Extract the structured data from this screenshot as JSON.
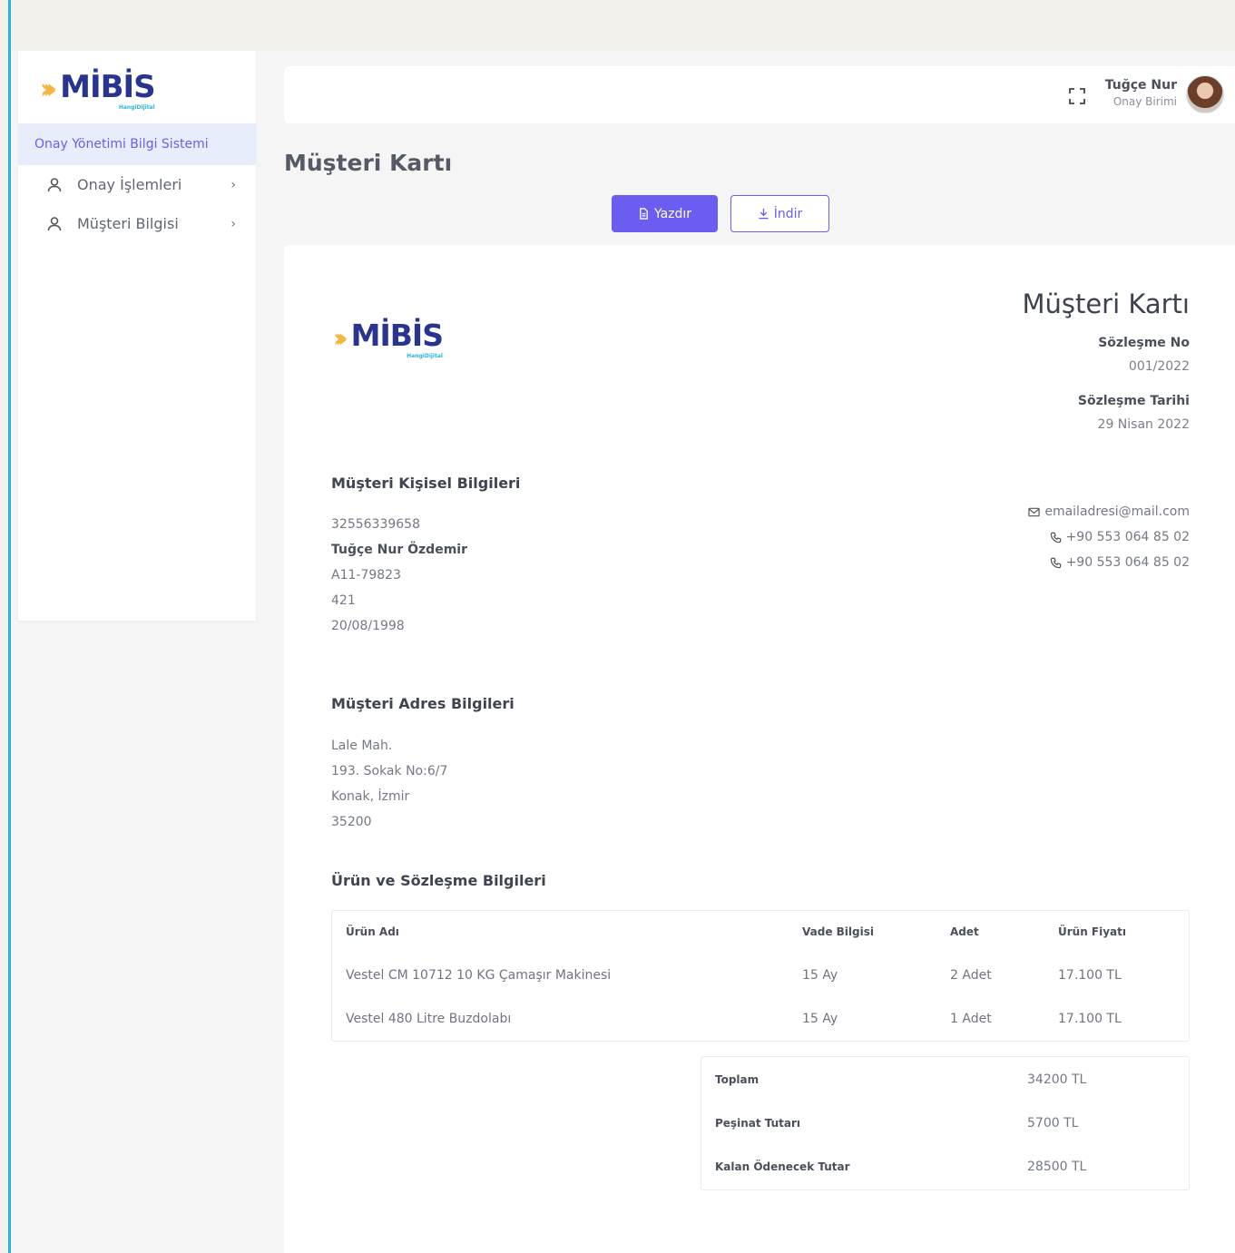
{
  "brand": {
    "name": "MİBİS",
    "tagline": "HangiDijital"
  },
  "sidebar": {
    "system_title": "Onay Yönetimi Bilgi Sistemi",
    "items": [
      {
        "label": "Onay İşlemleri",
        "icon": "user-icon"
      },
      {
        "label": "Müşteri Bilgisi",
        "icon": "user-icon"
      }
    ]
  },
  "header": {
    "user_name": "Tuğçe Nur",
    "user_role": "Onay Birimi"
  },
  "page": {
    "title": "Müşteri Kartı",
    "print_label": "Yazdır",
    "download_label": "İndir"
  },
  "card": {
    "title": "Müşteri Kartı",
    "contract_no_label": "Sözleşme No",
    "contract_no": "001/2022",
    "contract_date_label": "Sözleşme Tarihi",
    "contract_date": "29 Nisan 2022",
    "personal": {
      "title": "Müşteri Kişisel Bilgileri",
      "id_number": "32556339658",
      "full_name": "Tuğçe Nur Özdemir",
      "serial": "A11-79823",
      "code": "421",
      "birth_date": "20/08/1998"
    },
    "contact": {
      "email": "emailadresi@mail.com",
      "phone1": "+90 553 064 85 02",
      "phone2": "+90 553 064 85 02"
    },
    "address": {
      "title": "Müşteri Adres Bilgileri",
      "line1": "Lale Mah.",
      "line2": "193. Sokak No:6/7",
      "line3": "Konak, İzmir",
      "postal": "35200"
    },
    "products": {
      "title": "Ürün ve Sözleşme Bilgileri",
      "headers": [
        "Ürün Adı",
        "Vade Bilgisi",
        "Adet",
        "Ürün Fiyatı"
      ],
      "rows": [
        [
          "Vestel CM 10712 10 KG Çamaşır Makinesi",
          "15 Ay",
          "2 Adet",
          "17.100 TL"
        ],
        [
          "Vestel 480 Litre Buzdolabı",
          "15 Ay",
          "1 Adet",
          "17.100 TL"
        ]
      ]
    },
    "totals": [
      {
        "label": "Toplam",
        "value": "34200 TL"
      },
      {
        "label": "Peşinat Tutarı",
        "value": "5700 TL"
      },
      {
        "label": "Kalan Ödenecek Tutar",
        "value": "28500 TL"
      }
    ]
  },
  "colors": {
    "accent": "#6a5df0",
    "brand_navy": "#28348f",
    "brand_gold": "#f4b63f",
    "sidebar_active_bg": "#e8edfb"
  }
}
